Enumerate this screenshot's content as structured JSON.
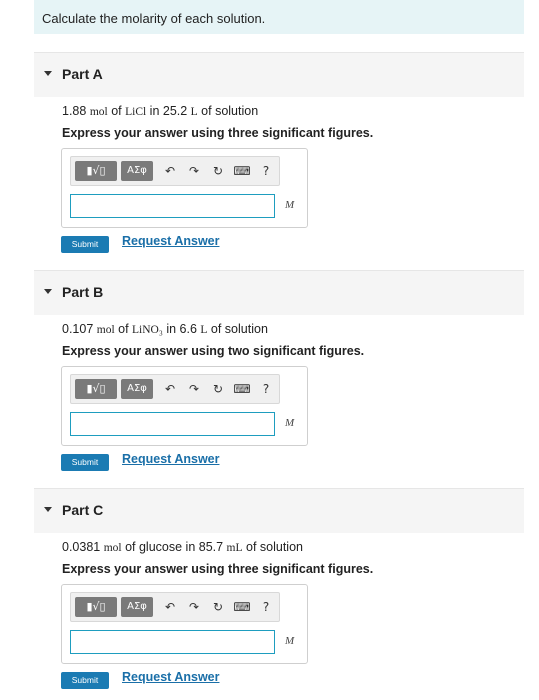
{
  "intro": "Calculate the molarity of each solution.",
  "toolbar": {
    "template_glyph": "▮√▯",
    "greek_glyph": "ΑΣφ",
    "icons": [
      "undo-icon",
      "redo-icon",
      "reset-icon",
      "keyboard-icon",
      "help-icon"
    ],
    "undo": "↶",
    "redo": "↷",
    "reset": "↻",
    "keyboard": "⌨",
    "help": "?"
  },
  "unit": "M",
  "submit_label": "Submit",
  "request_label": "Request Answer",
  "parts": [
    {
      "title": "Part A",
      "q_value": "1.88",
      "q_unit1": "mol",
      "q_mid": " of ",
      "q_species": "LiCl",
      "q_mid2": " in 25.2 ",
      "q_unit2": "L",
      "q_end": " of solution",
      "instruction": "Express your answer using three significant figures.",
      "answer": ""
    },
    {
      "title": "Part B",
      "q_value": "0.107",
      "q_unit1": "mol",
      "q_mid": " of ",
      "q_species": "LiNO₃",
      "q_mid2": " in 6.6 ",
      "q_unit2": "L",
      "q_end": " of solution",
      "instruction": "Express your answer using two significant figures.",
      "answer": ""
    },
    {
      "title": "Part C",
      "q_value": "0.0381",
      "q_unit1": "mol",
      "q_mid": " of glucose in 85.7 ",
      "q_species": "",
      "q_mid2": "",
      "q_unit2": "mL",
      "q_end": " of solution",
      "instruction": "Express your answer using three significant figures.",
      "answer": ""
    }
  ]
}
